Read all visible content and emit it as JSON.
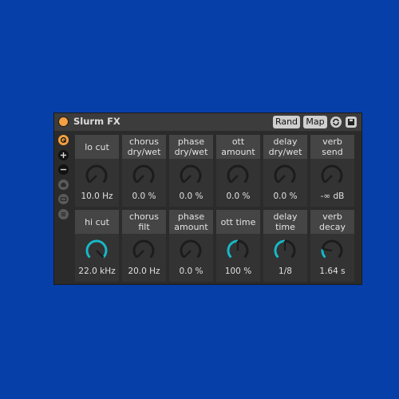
{
  "device": {
    "title": "Slurm FX",
    "rand_label": "Rand",
    "map_label": "Map",
    "power_color": "#f5a040",
    "accent_color": "#f5a040",
    "knob_active_color": "#18b8c8"
  },
  "sidebar": {
    "items": [
      {
        "name": "hot-swap-icon",
        "glyph": "⟲"
      },
      {
        "name": "add-icon",
        "glyph": "+"
      },
      {
        "name": "remove-icon",
        "glyph": "−"
      },
      {
        "name": "camera-icon",
        "glyph": ""
      },
      {
        "name": "window-icon",
        "glyph": ""
      },
      {
        "name": "list-icon",
        "glyph": ""
      }
    ]
  },
  "params": [
    {
      "label": "lo cut",
      "value": "10.0 Hz",
      "level": 0.0,
      "active": false
    },
    {
      "label": "chorus\ndry/wet",
      "value": "0.0 %",
      "level": 0.0,
      "active": false
    },
    {
      "label": "phase\ndry/wet",
      "value": "0.0 %",
      "level": 0.0,
      "active": false
    },
    {
      "label": "ott\namount",
      "value": "0.0 %",
      "level": 0.0,
      "active": false
    },
    {
      "label": "delay\ndry/wet",
      "value": "0.0 %",
      "level": 0.0,
      "active": false
    },
    {
      "label": "verb\nsend",
      "value": "-∞ dB",
      "level": 0.0,
      "active": false
    },
    {
      "label": "hi cut",
      "value": "22.0 kHz",
      "level": 1.0,
      "active": true
    },
    {
      "label": "chorus\nfilt",
      "value": "20.0 Hz",
      "level": 0.0,
      "active": false
    },
    {
      "label": "phase\namount",
      "value": "0.0 %",
      "level": 0.0,
      "active": false
    },
    {
      "label": "ott time",
      "value": "100 %",
      "level": 0.5,
      "active": true
    },
    {
      "label": "delay\ntime",
      "value": "1/8",
      "level": 0.5,
      "active": true
    },
    {
      "label": "verb\ndecay",
      "value": "1.64 s",
      "level": 0.2,
      "active": true
    }
  ]
}
